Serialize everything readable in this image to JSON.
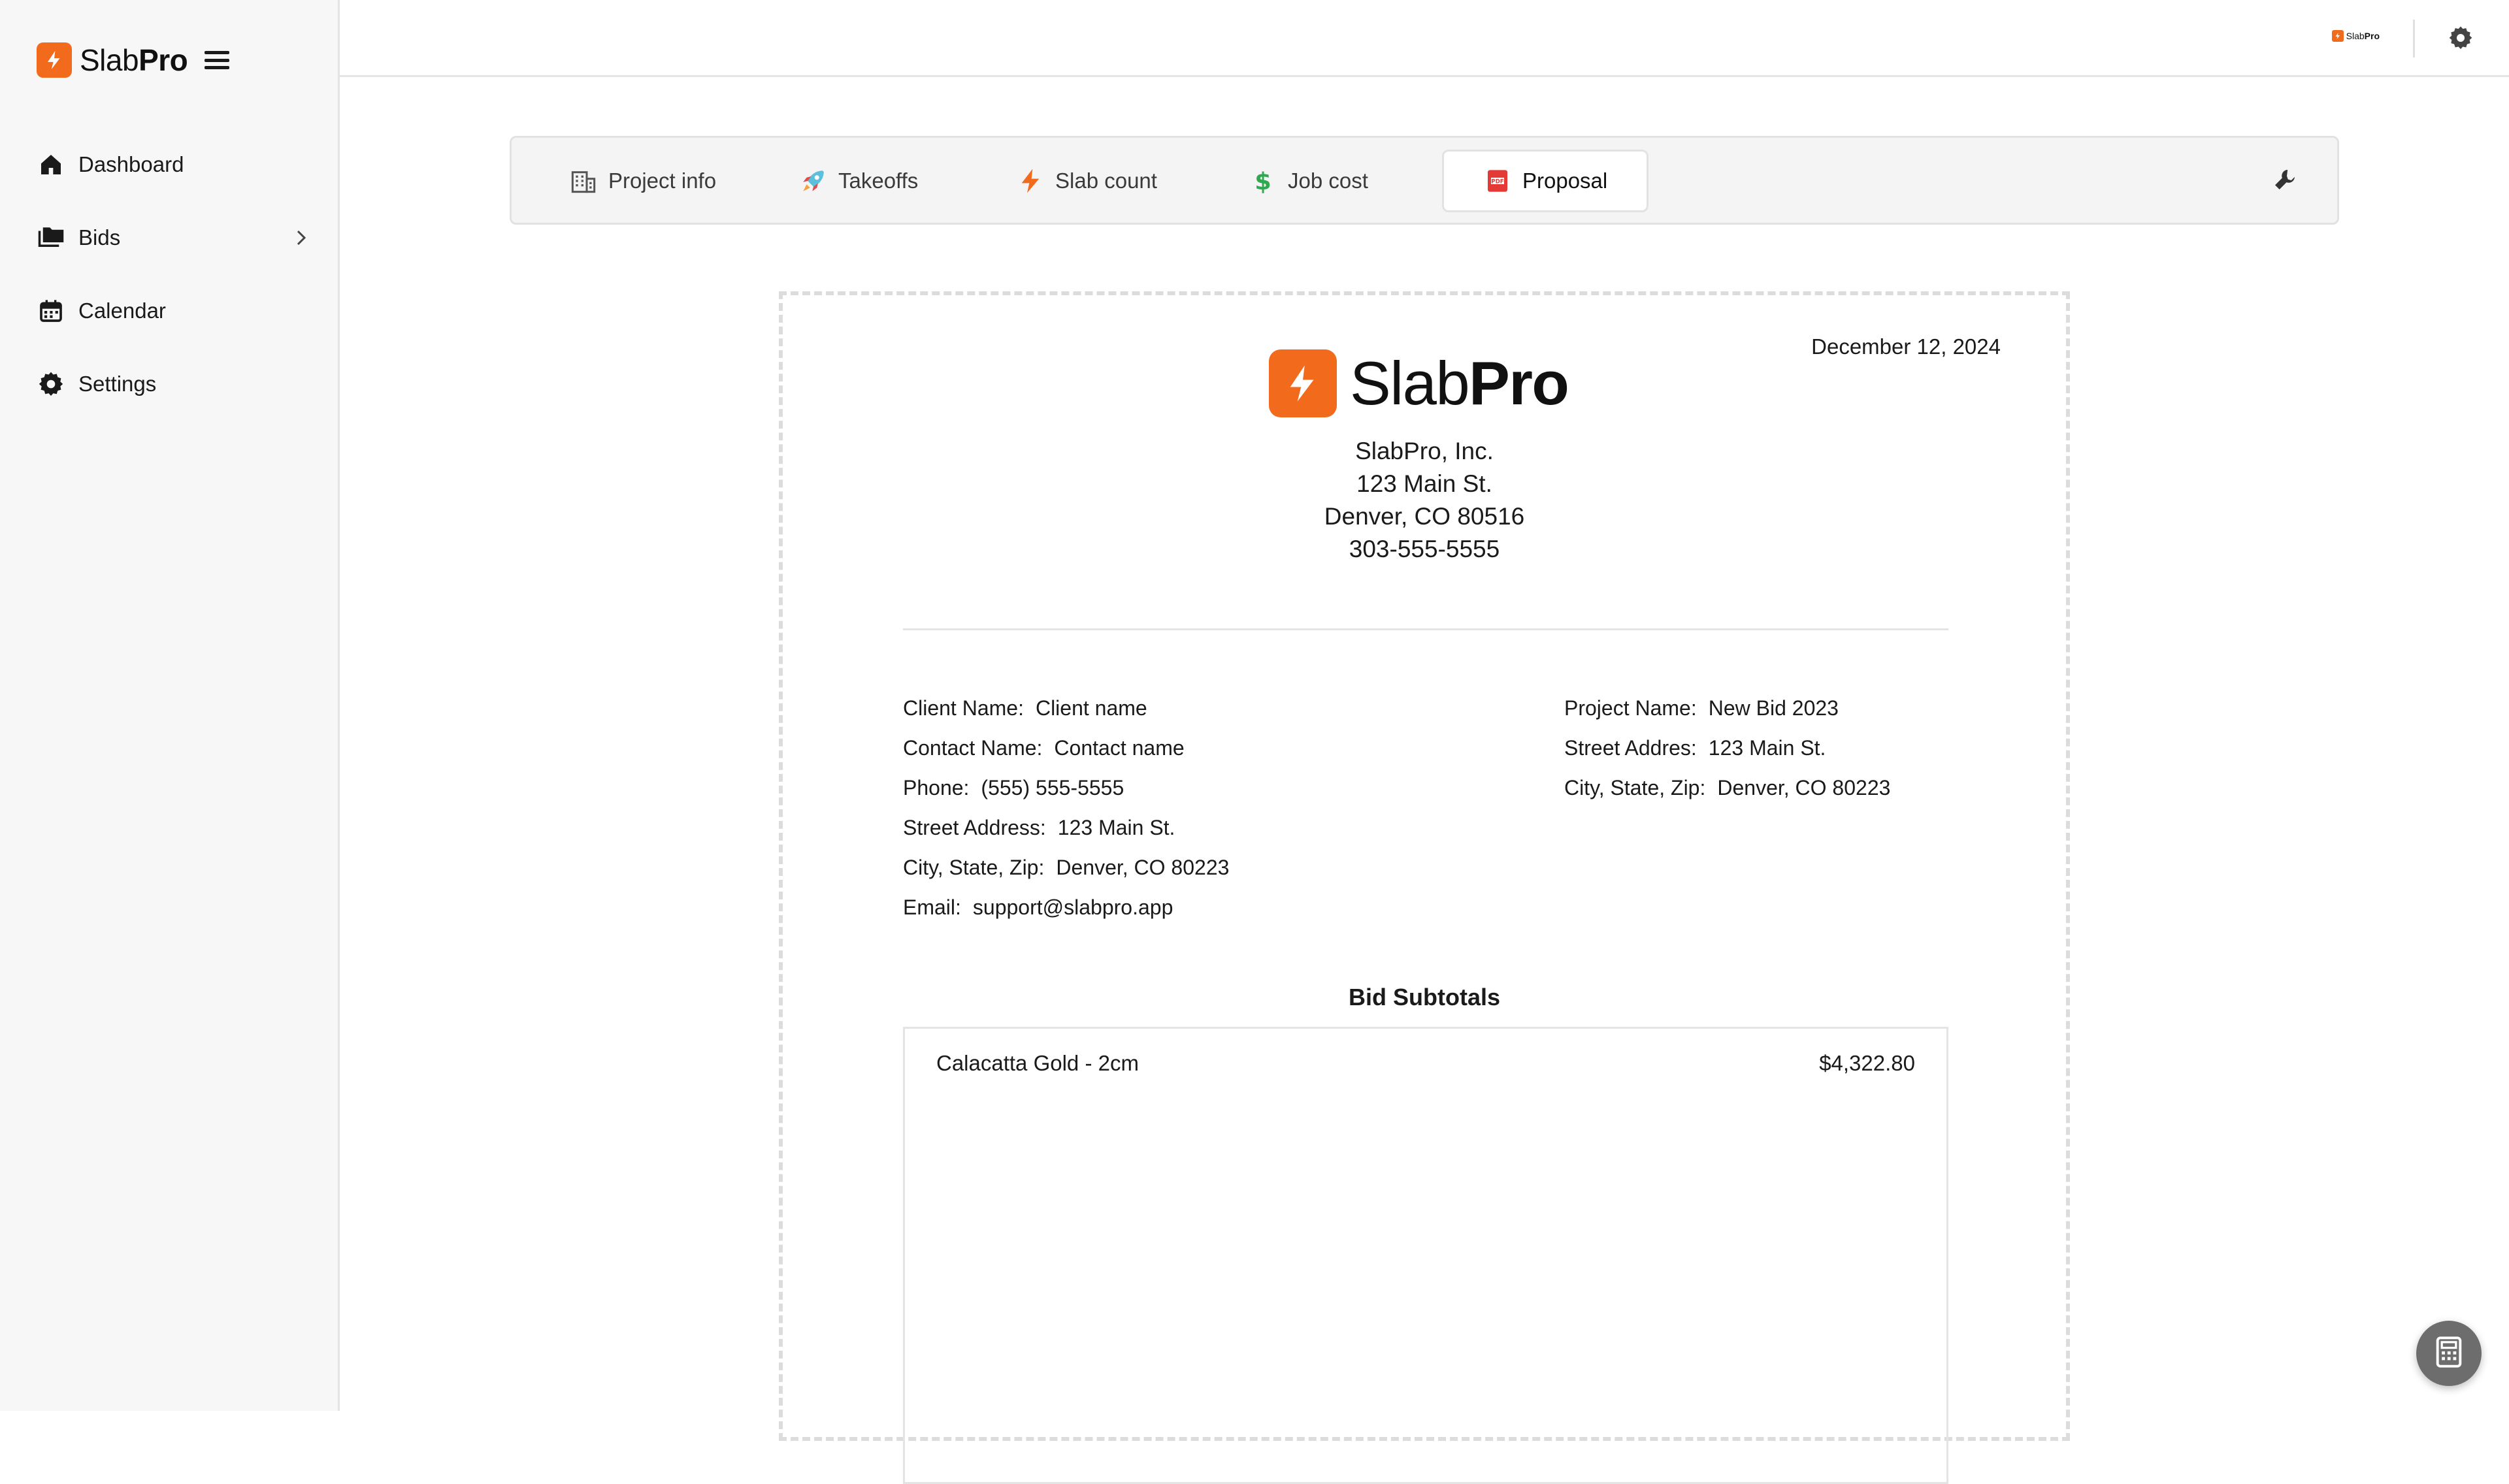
{
  "brand": {
    "name_part1": "Slab",
    "name_part2": "Pro",
    "color": "#f26b1d"
  },
  "sidebar": {
    "items": [
      {
        "label": "Dashboard",
        "icon": "home-icon"
      },
      {
        "label": "Bids",
        "icon": "folder-icon",
        "has_submenu": true
      },
      {
        "label": "Calendar",
        "icon": "calendar-icon"
      },
      {
        "label": "Settings",
        "icon": "gear-icon"
      }
    ]
  },
  "header": {
    "settings_icon": "gear-icon"
  },
  "tabs": [
    {
      "label": "Project info",
      "icon": "building-icon"
    },
    {
      "label": "Takeoffs",
      "icon": "rocket-icon"
    },
    {
      "label": "Slab count",
      "icon": "lightning-icon"
    },
    {
      "label": "Job cost",
      "icon": "dollar-icon"
    },
    {
      "label": "Proposal",
      "icon": "pdf-icon",
      "active": true
    }
  ],
  "tools_icon": "wrench-icon",
  "proposal": {
    "date": "December 12, 2024",
    "company": {
      "name": "SlabPro, Inc.",
      "street": "123 Main St.",
      "city_state_zip": "Denver, CO 80516",
      "phone": "303-555-5555"
    },
    "client": [
      {
        "label": "Client Name:",
        "value": "Client name"
      },
      {
        "label": "Contact Name:",
        "value": "Contact name"
      },
      {
        "label": "Phone:",
        "value": "(555) 555-5555"
      },
      {
        "label": "Street Address:",
        "value": "123 Main St."
      },
      {
        "label": "City, State, Zip:",
        "value": "Denver, CO 80223"
      },
      {
        "label": "Email:",
        "value": "support@slabpro.app"
      }
    ],
    "project": [
      {
        "label": "Project Name:",
        "value": "New Bid 2023"
      },
      {
        "label": "Street Addres:",
        "value": "123 Main St."
      },
      {
        "label": "City, State, Zip:",
        "value": "Denver, CO 80223"
      }
    ],
    "subtotals_title": "Bid Subtotals",
    "subtotals": [
      {
        "item": "Calacatta Gold - 2cm",
        "amount": "$4,322.80"
      }
    ]
  },
  "fab_icon": "calculator-icon"
}
